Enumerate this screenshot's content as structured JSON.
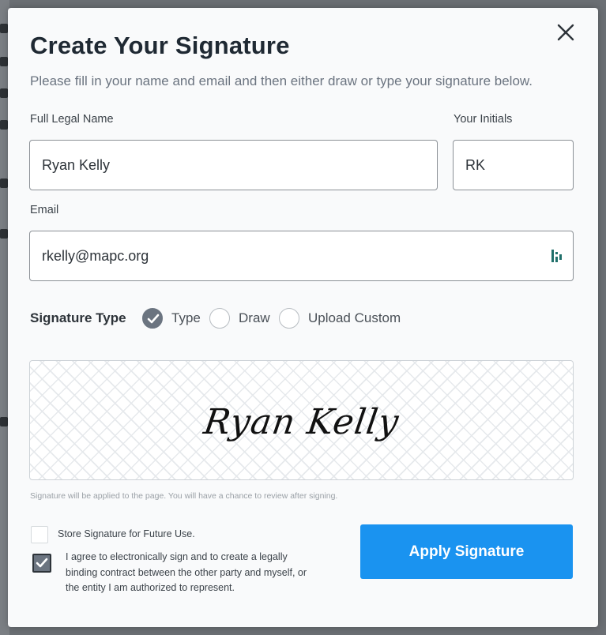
{
  "modal": {
    "title": "Create Your Signature",
    "subtitle": "Please fill in your name and email and then either draw or type your signature below."
  },
  "form": {
    "full_name_label": "Full Legal Name",
    "full_name_value": "Ryan Kelly",
    "initials_label": "Your Initials",
    "initials_value": "RK",
    "email_label": "Email",
    "email_value": "rkelly@mapc.org"
  },
  "signature_type": {
    "label": "Signature Type",
    "options": [
      {
        "label": "Type",
        "selected": true
      },
      {
        "label": "Draw",
        "selected": false
      },
      {
        "label": "Upload Custom",
        "selected": false
      }
    ]
  },
  "signature_preview": {
    "text": "Ryan Kelly"
  },
  "hint": "Signature will be applied to the page. You will have a chance to review after signing.",
  "options": {
    "store_label": "Store Signature for Future Use.",
    "store_checked": false,
    "agree_label": "I agree to electronically sign and to create a legally binding contract between the other party and myself, or the entity I am authorized to represent.",
    "agree_checked": true
  },
  "apply_button": "Apply Signature",
  "icons": {
    "close": "close-icon",
    "password_manager": "password-manager-icon",
    "check": "check-icon"
  },
  "colors": {
    "accent": "#1a93f0",
    "radio_selected": "#6b7480",
    "title": "#1f2933"
  }
}
